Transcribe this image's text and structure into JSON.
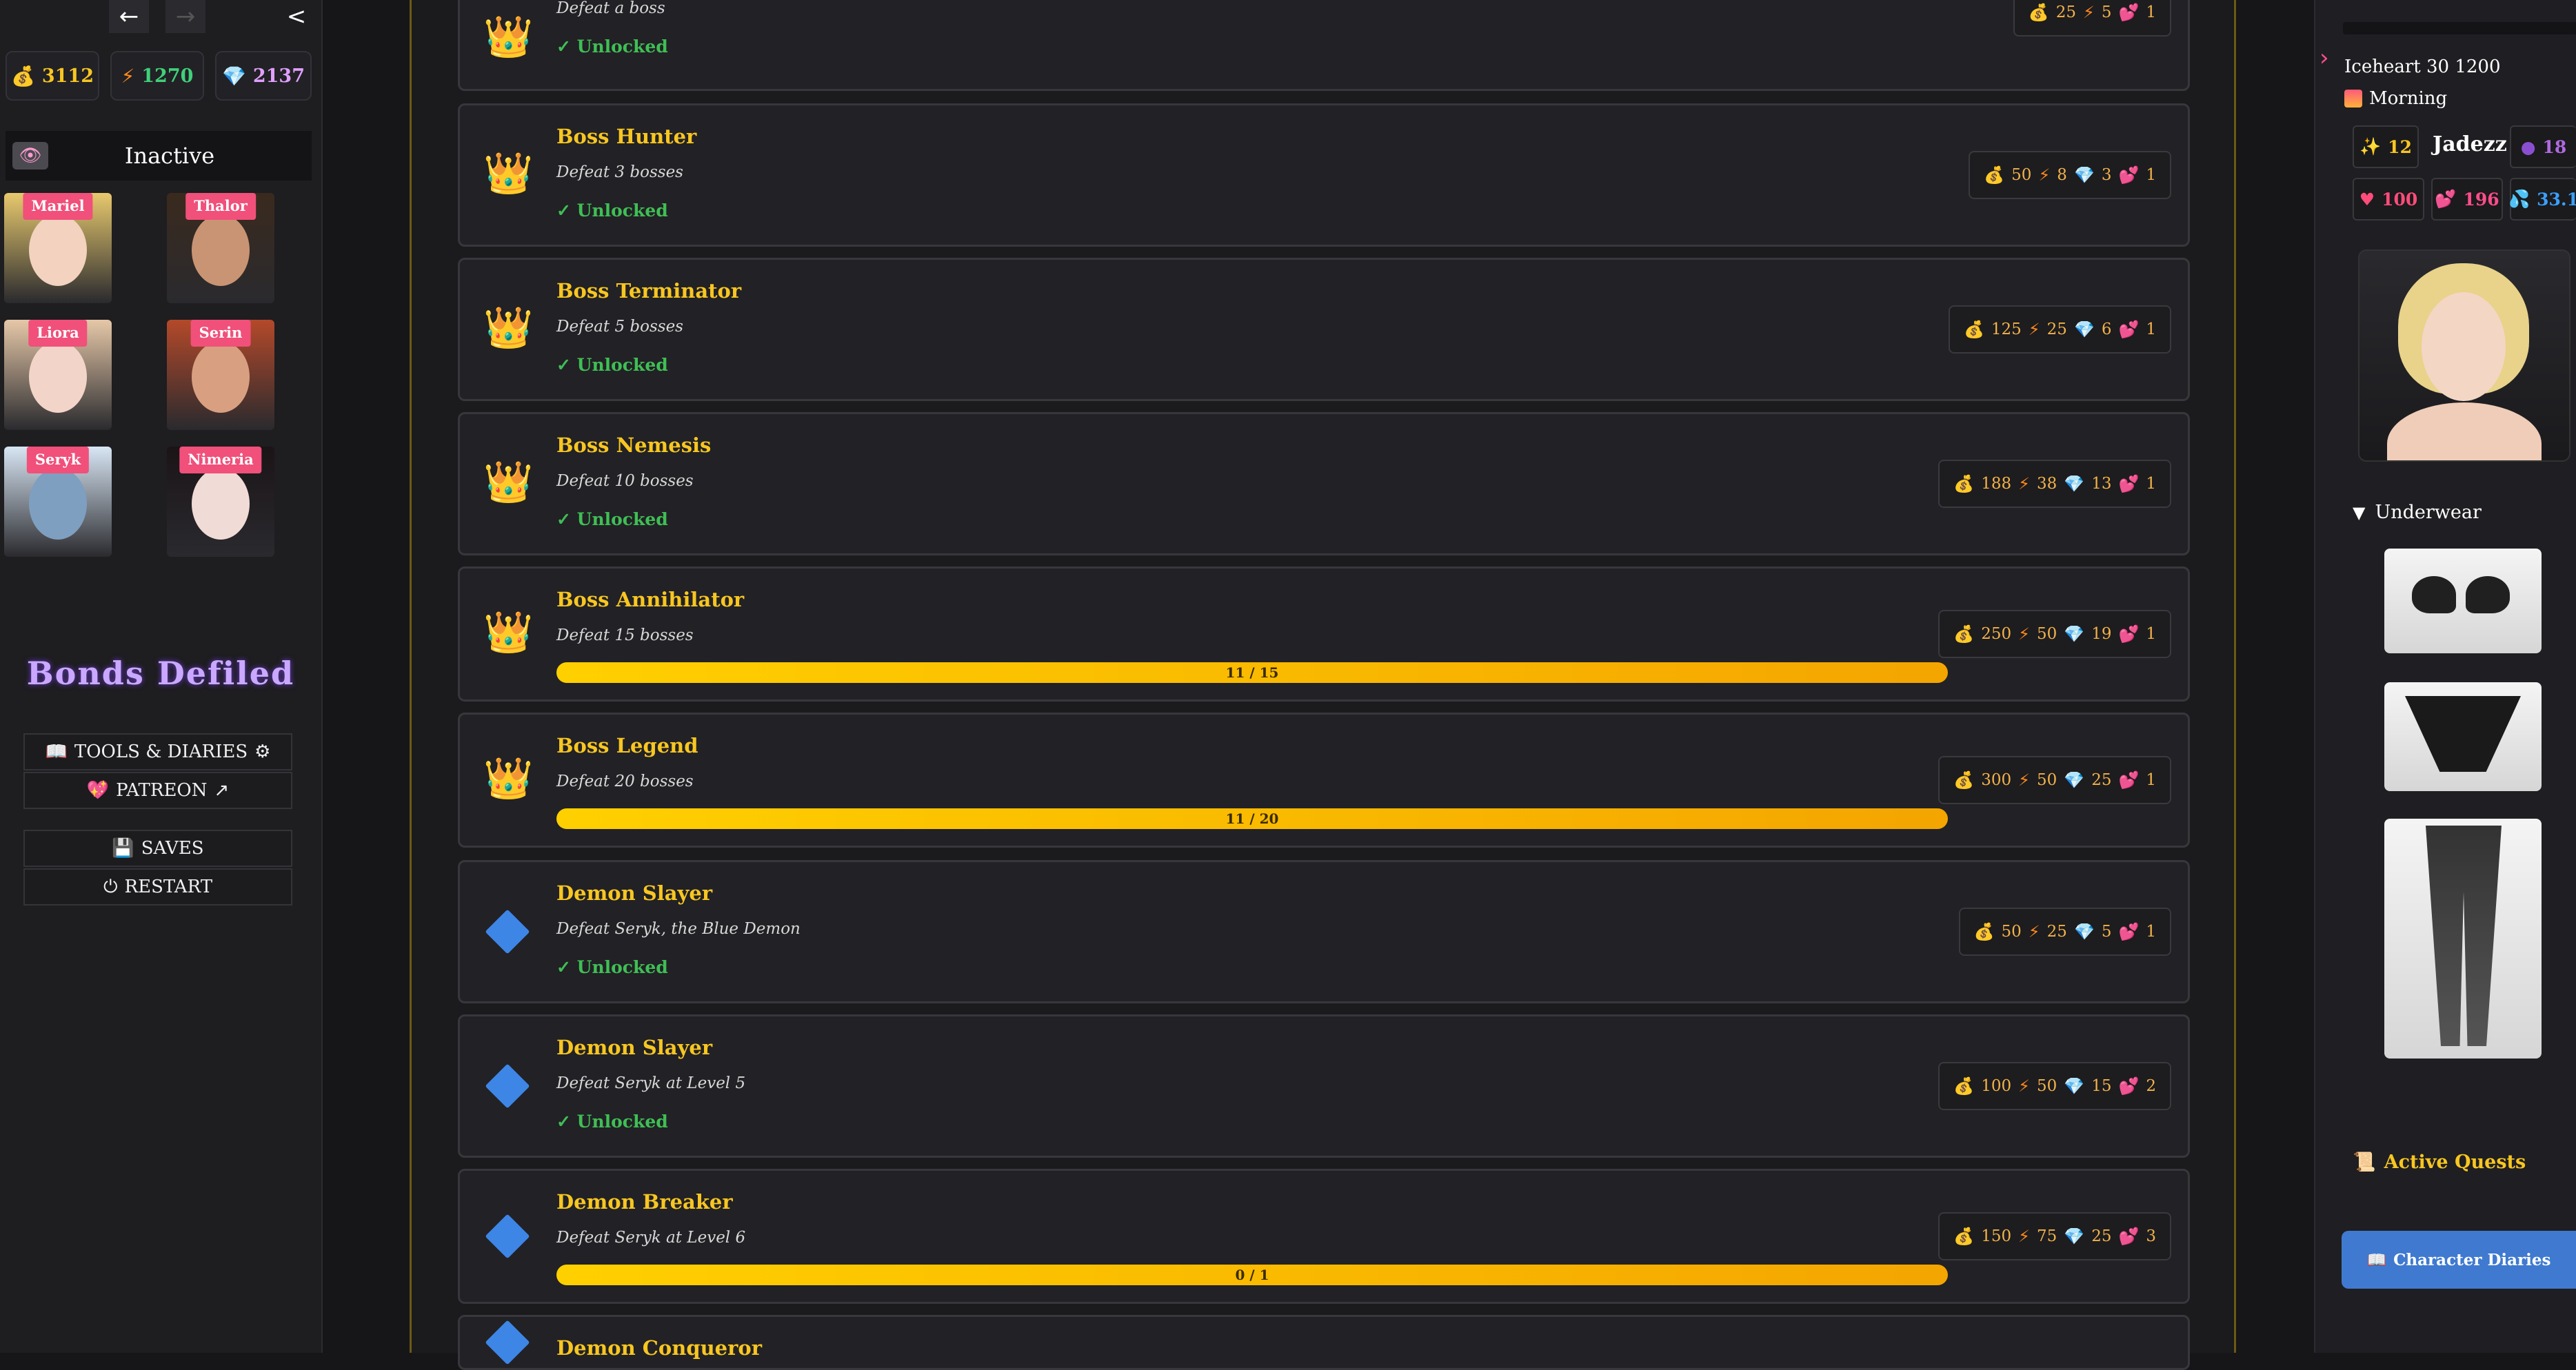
{
  "left": {
    "nav": {
      "back": "←",
      "forward": "→",
      "collapse": "<"
    },
    "resources": [
      {
        "icon": "💰",
        "value": "3112",
        "color": "#f7c621"
      },
      {
        "icon": "⚡",
        "value": "1270",
        "color": "#3fd07a"
      },
      {
        "icon": "💎",
        "value": "2137",
        "color": "#e0a0ff"
      }
    ],
    "status": {
      "eye_icon": "👁",
      "label": "Inactive"
    },
    "characters": [
      {
        "name": "Mariel",
        "hair": "#e8c96e",
        "skin": "#f3d2bf"
      },
      {
        "name": "Thalor",
        "hair": "#3a2a1e",
        "skin": "#c99473"
      },
      {
        "name": "Liora",
        "hair": "#e6c8a8",
        "skin": "#f2d5c8"
      },
      {
        "name": "Serin",
        "hair": "#b4492a",
        "skin": "#d8a081"
      },
      {
        "name": "Seryk",
        "hair": "#d8e6f4",
        "skin": "#7f9fc0"
      },
      {
        "name": "Nimeria",
        "hair": "#1b1417",
        "skin": "#f1dbd6"
      }
    ],
    "title": "Bonds Defiled",
    "menu": {
      "tools": {
        "icon_l": "📖",
        "label": "TOOLS & DIARIES",
        "icon_r": "⚙"
      },
      "patreon": {
        "icon_l": "💖",
        "label": "PATREON",
        "icon_r": "↗"
      },
      "saves": {
        "icon_l": "💾",
        "label": "SAVES"
      },
      "restart": {
        "icon_l": "⏻",
        "label": "RESTART"
      }
    }
  },
  "achievements": [
    {
      "title": "",
      "description": "Defeat a boss",
      "status": "✓ Unlocked",
      "icon": "crown",
      "rewards": [
        "25",
        "5",
        "1"
      ],
      "gem": false
    },
    {
      "title": "Boss Hunter",
      "description": "Defeat 3 bosses",
      "status": "✓ Unlocked",
      "icon": "crown",
      "rewards": [
        "50",
        "8",
        "3",
        "1"
      ],
      "gem": true
    },
    {
      "title": "Boss Terminator",
      "description": "Defeat 5 bosses",
      "status": "✓ Unlocked",
      "icon": "crown",
      "rewards": [
        "125",
        "25",
        "6",
        "1"
      ],
      "gem": true
    },
    {
      "title": "Boss Nemesis",
      "description": "Defeat 10 bosses",
      "status": "✓ Unlocked",
      "icon": "crown",
      "rewards": [
        "188",
        "38",
        "13",
        "1"
      ],
      "gem": true
    },
    {
      "title": "Boss Annihilator",
      "description": "Defeat 15 bosses",
      "progress": "11 / 15",
      "icon": "crown",
      "rewards": [
        "250",
        "50",
        "19",
        "1"
      ],
      "gem": true
    },
    {
      "title": "Boss Legend",
      "description": "Defeat 20 bosses",
      "progress": "11 / 20",
      "icon": "crown",
      "rewards": [
        "300",
        "50",
        "25",
        "1"
      ],
      "gem": true
    },
    {
      "title": "Demon Slayer",
      "description": "Defeat Seryk, the Blue Demon",
      "status": "✓ Unlocked",
      "icon": "diamond",
      "rewards": [
        "50",
        "25",
        "5",
        "1"
      ],
      "gem": true
    },
    {
      "title": "Demon Slayer",
      "description": "Defeat Seryk at Level 5",
      "status": "✓ Unlocked",
      "icon": "diamond",
      "rewards": [
        "100",
        "50",
        "15",
        "2"
      ],
      "gem": true
    },
    {
      "title": "Demon Breaker",
      "description": "Defeat Seryk at Level 6",
      "progress": "0 / 1",
      "icon": "diamond",
      "rewards": [
        "150",
        "75",
        "25",
        "3"
      ],
      "gem": true
    },
    {
      "title": "Demon Conqueror",
      "description": "",
      "icon": "diamond",
      "rewards": [],
      "gem": false
    }
  ],
  "right": {
    "location": "Iceheart 30 1200",
    "time_of_day": "Morning",
    "character_name": "Jadezz",
    "stats": {
      "sparkle": {
        "icon": "✨",
        "value": "12",
        "color": "#f7c621"
      },
      "orb": {
        "icon": "●",
        "value": "18",
        "color": "#b06ae0"
      },
      "health": {
        "icon": "♥",
        "value": "100",
        "color": "#ff4d7a"
      },
      "love": {
        "icon": "💕",
        "value": "196",
        "color": "#ff4d8a"
      },
      "drops": {
        "icon": "💦",
        "value": "33.1",
        "color": "#3aa0ff"
      }
    },
    "underwear_label": "Underwear",
    "active_quests": {
      "icon": "📜",
      "label": "Active Quests"
    },
    "diaries_button": {
      "icon": "📖",
      "label": "Character Diaries"
    }
  }
}
